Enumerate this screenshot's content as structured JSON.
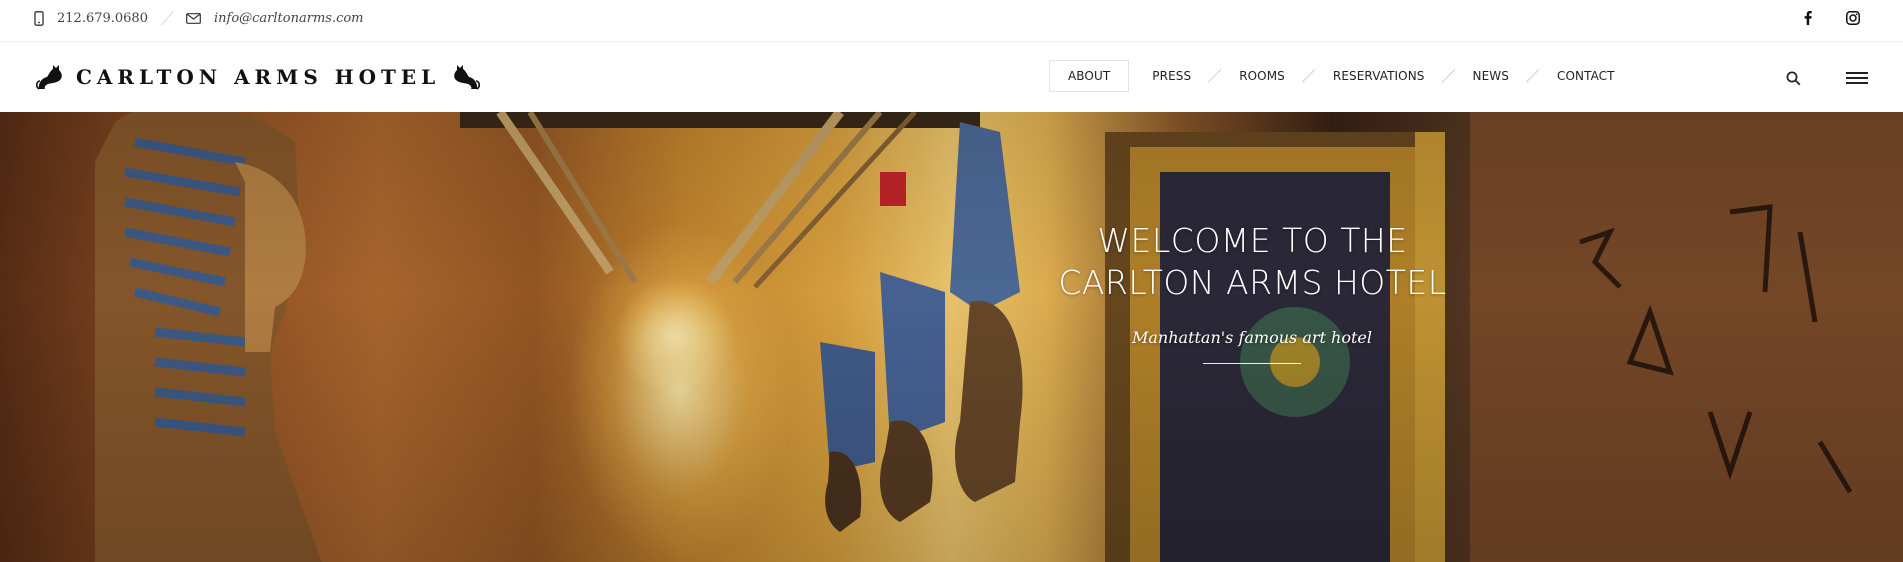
{
  "topbar": {
    "phone": "212.679.0680",
    "email": "info@carltonarms.com",
    "social": [
      "facebook-icon",
      "instagram-icon"
    ]
  },
  "header": {
    "logo_text": "CARLTON ARMS HOTEL",
    "nav": [
      {
        "label": "ABOUT",
        "active": true
      },
      {
        "label": "PRESS"
      },
      {
        "label": "ROOMS"
      },
      {
        "label": "RESERVATIONS"
      },
      {
        "label": "NEWS"
      },
      {
        "label": "CONTACT"
      }
    ]
  },
  "hero": {
    "title_line1": "WELCOME TO THE",
    "title_line2": "CARLTON ARMS HOTEL",
    "subtitle": "Manhattan's famous art hotel"
  },
  "colors": {
    "text": "#222222",
    "muted": "#444444",
    "divider": "#eeeeee",
    "hero_warm": "#e0a640"
  }
}
